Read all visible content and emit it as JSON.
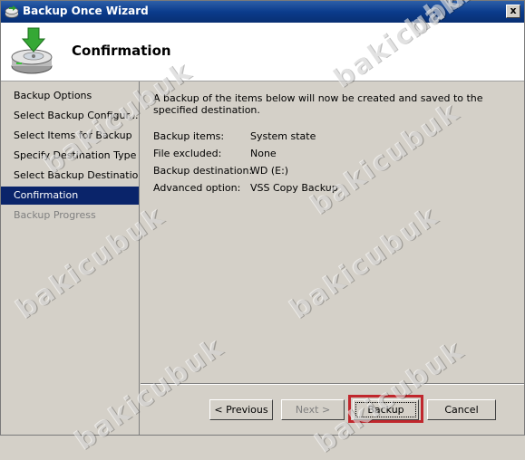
{
  "window": {
    "title": "Backup Once Wizard",
    "close_label": "x"
  },
  "header": {
    "title": "Confirmation",
    "icon": "backup-disk-icon"
  },
  "sidebar": {
    "items": [
      {
        "label": "Backup Options",
        "state": "normal"
      },
      {
        "label": "Select Backup Configur...",
        "state": "normal"
      },
      {
        "label": "Select Items for Backup",
        "state": "normal"
      },
      {
        "label": "Specify Destination Type",
        "state": "normal"
      },
      {
        "label": "Select Backup Destination",
        "state": "normal"
      },
      {
        "label": "Confirmation",
        "state": "active"
      },
      {
        "label": "Backup Progress",
        "state": "disabled"
      }
    ]
  },
  "content": {
    "intro": "A backup of the items below will now be created and saved to the specified destination.",
    "details": [
      {
        "key": "Backup items:",
        "value": "System state"
      },
      {
        "key": "File excluded:",
        "value": "None"
      },
      {
        "key": "Backup destination:",
        "value": "WD (E:)"
      },
      {
        "key": "Advanced option:",
        "value": "VSS Copy Backup"
      }
    ]
  },
  "buttons": {
    "previous": "< Previous",
    "next": "Next >",
    "backup": "Backup",
    "cancel": "Cancel"
  },
  "watermark": "bakicubuk",
  "colors": {
    "titlebar": "#0b3c8c",
    "selection": "#0a246a",
    "highlight": "#c0272d",
    "face": "#d4d0c8"
  }
}
